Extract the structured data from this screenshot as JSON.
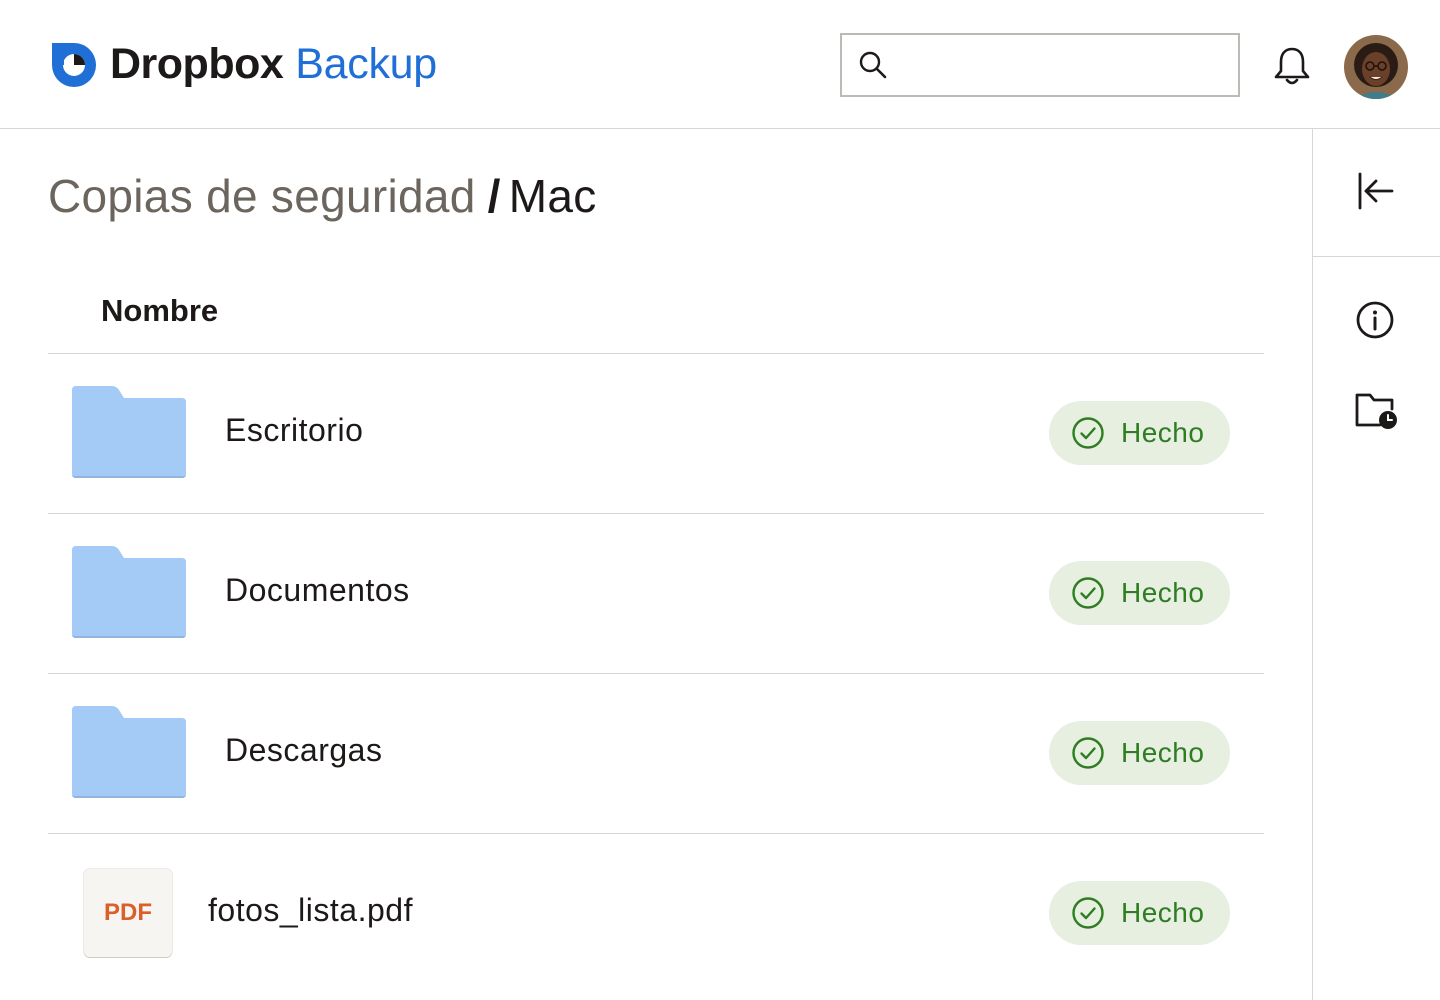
{
  "header": {
    "brand": "Dropbox",
    "product": "Backup",
    "search": {
      "value": "",
      "placeholder": ""
    },
    "icons": {
      "logo": "dropbox-logo-icon",
      "search": "search-icon",
      "notifications": "bell-icon",
      "avatar": "user-avatar"
    }
  },
  "breadcrumb": {
    "parent": "Copias de seguridad",
    "separator": "/",
    "current": "Mac"
  },
  "table": {
    "columns": {
      "name": "Nombre"
    },
    "rows": [
      {
        "name": "Escritorio",
        "type": "folder",
        "status": "Hecho"
      },
      {
        "name": "Documentos",
        "type": "folder",
        "status": "Hecho"
      },
      {
        "name": "Descargas",
        "type": "folder",
        "status": "Hecho"
      },
      {
        "name": "fotos_lista.pdf",
        "type": "pdf",
        "type_label": "PDF",
        "status": "Hecho"
      }
    ]
  },
  "rail": {
    "icons": [
      "collapse-panel-icon",
      "info-icon",
      "folder-clock-icon"
    ]
  },
  "colors": {
    "brand_blue": "#1f6fd6",
    "folder_blue": "#a4cbf6",
    "status_bg": "#e6efe0",
    "status_text": "#2e7d22",
    "pdf_text": "#d95f2b"
  }
}
